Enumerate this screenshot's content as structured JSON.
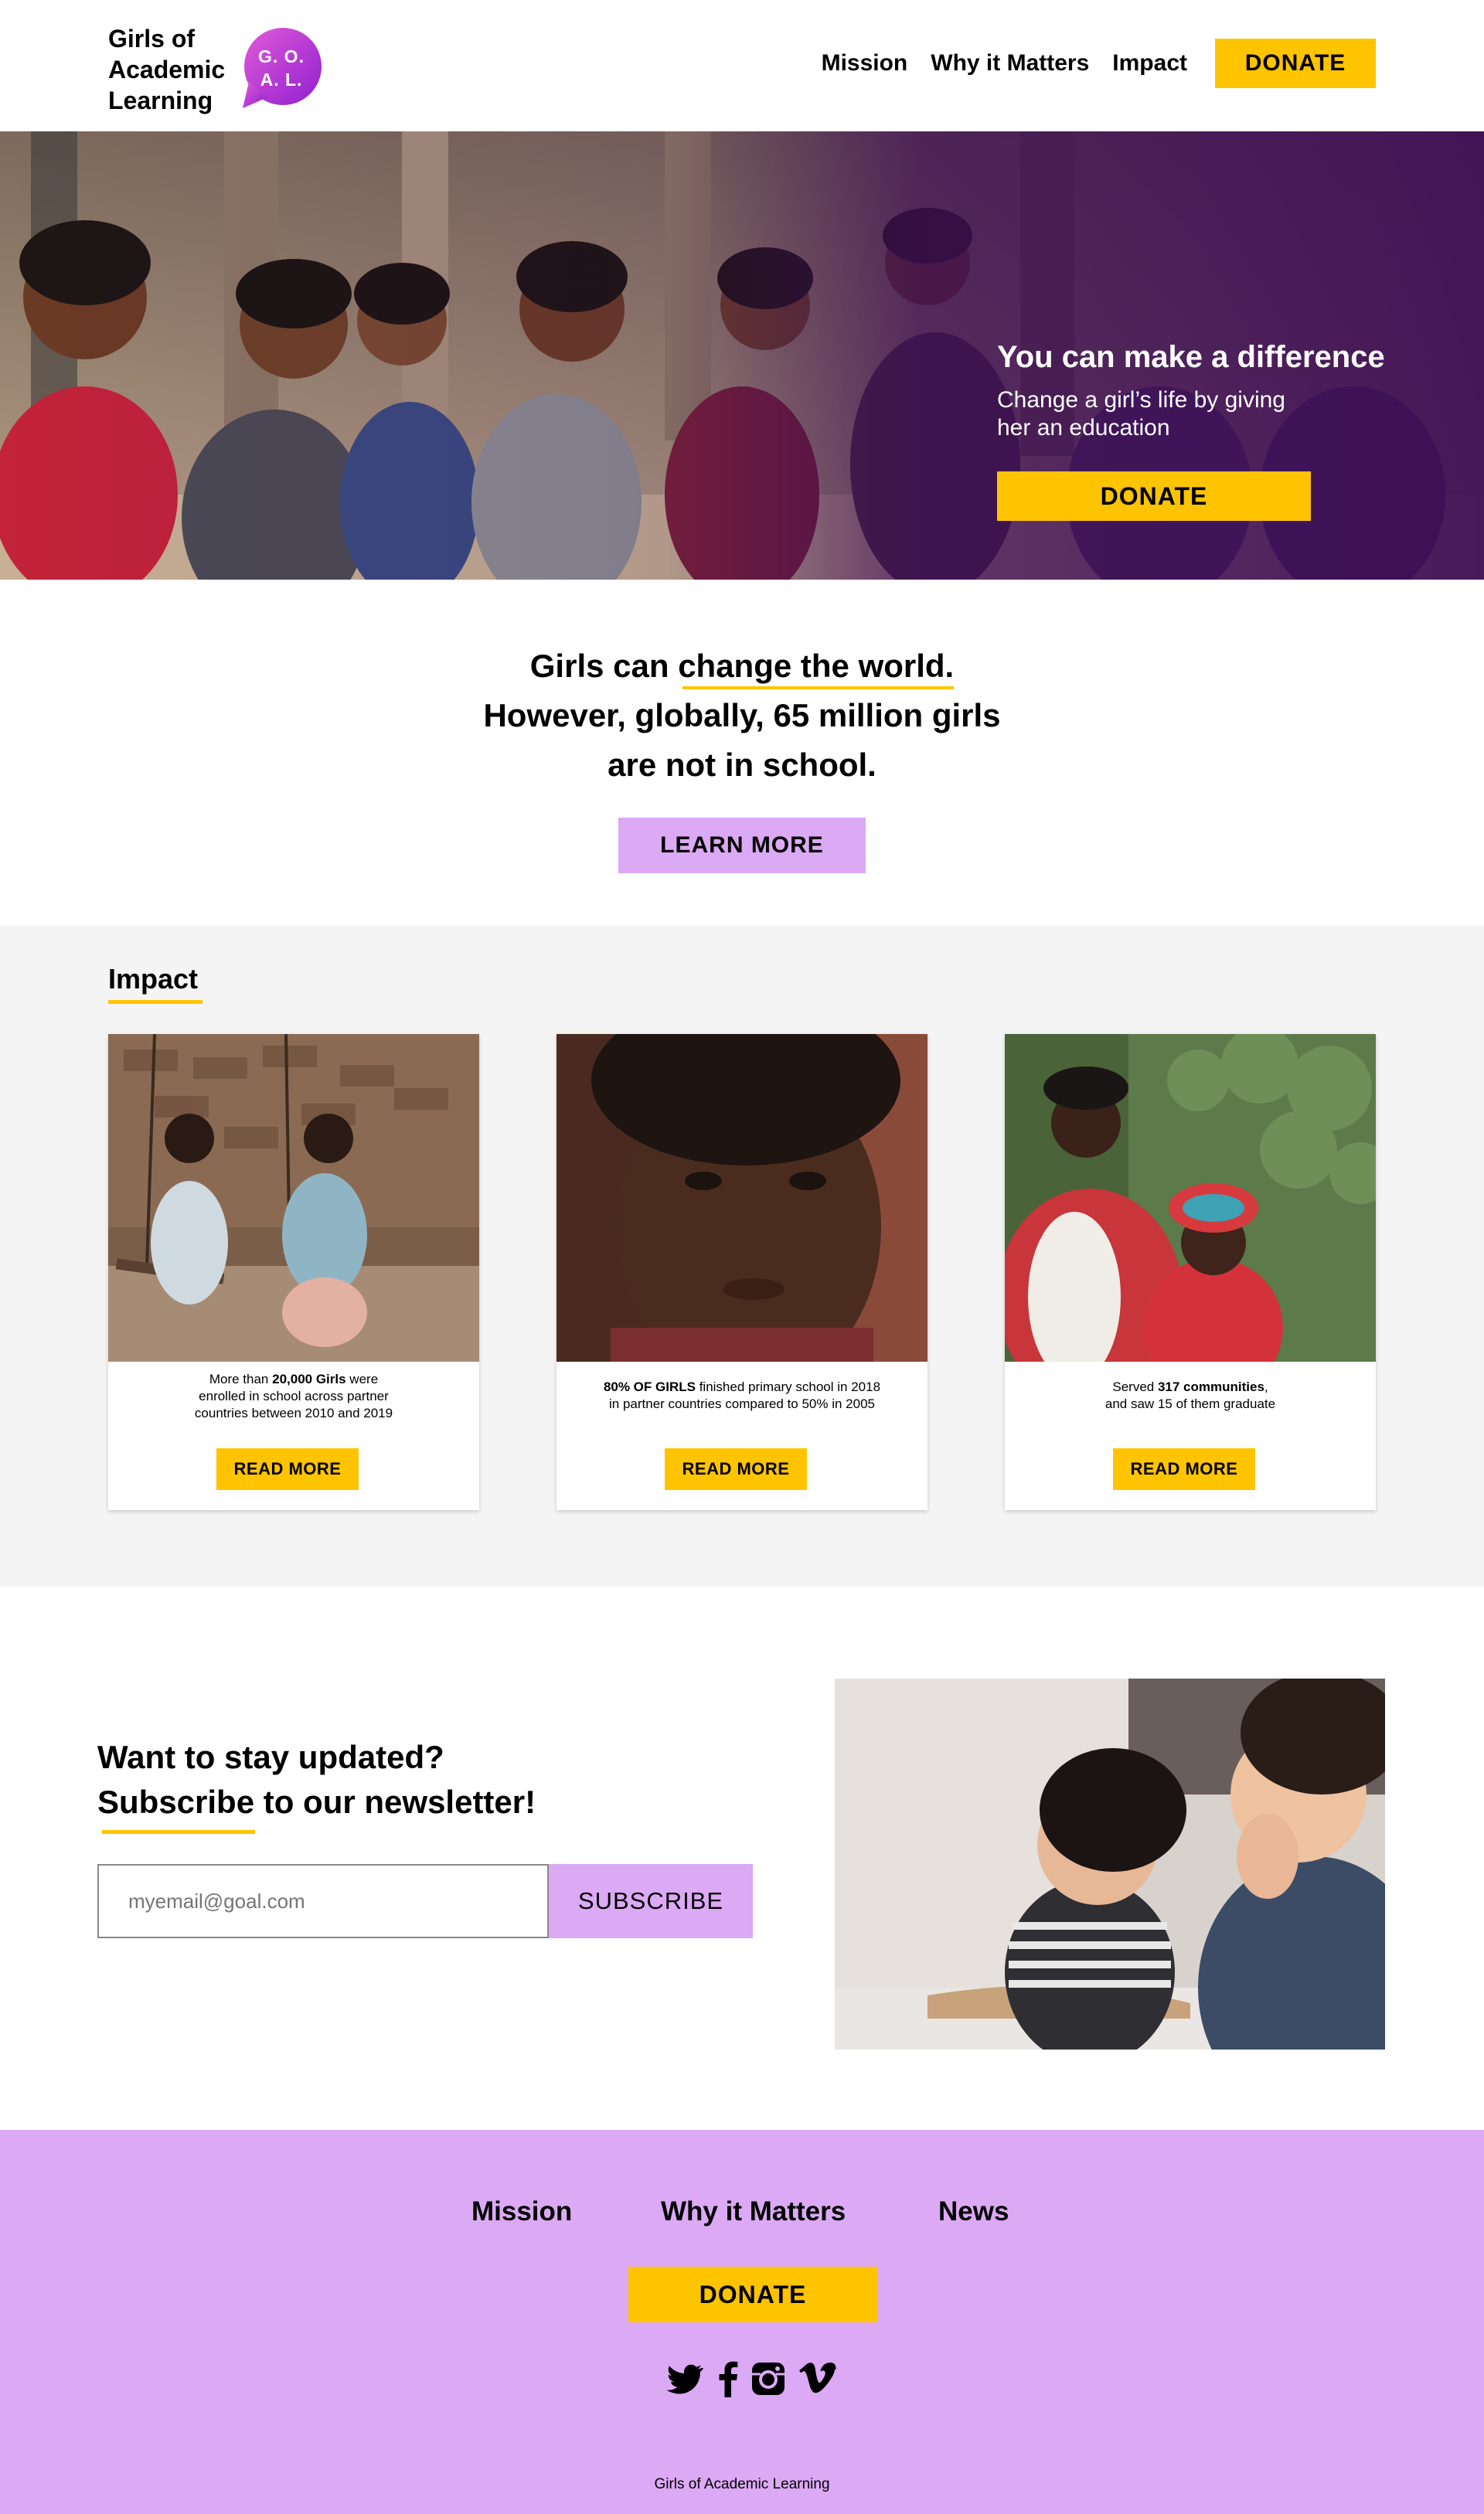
{
  "brand": {
    "name_line1": "Girls of",
    "name_line2": "Academic",
    "name_line3": "Learning",
    "badge_line1": "G. O.",
    "badge_line2": "A. L."
  },
  "nav": {
    "mission": "Mission",
    "why": "Why it Matters",
    "impact": "Impact",
    "donate": "DONATE"
  },
  "hero": {
    "title": "You can make a difference",
    "subtitle": "Change a girl’s life by giving her an education",
    "donate": "DONATE"
  },
  "statement": {
    "part1": "Girls can ",
    "highlight": "change the world.",
    "line2": "However, globally, 65 million girls",
    "line3": "are not in school.",
    "learn_more": "LEARN MORE"
  },
  "impact": {
    "title": "Impact",
    "cards": [
      {
        "pre": "More than ",
        "bold": "20,000 Girls",
        "post": " were",
        "line2": "enrolled in school across partner",
        "line3": "countries between 2010 and 2019",
        "button": "READ MORE"
      },
      {
        "bold": "80% OF GIRLS",
        "post": " finished primary school in 2018",
        "line2": "in partner countries compared to 50% in 2005",
        "button": "READ MORE"
      },
      {
        "pre": "Served ",
        "bold": "317 communities",
        "post": ",",
        "line2": "and saw 15 of them graduate",
        "button": "READ MORE"
      }
    ]
  },
  "newsletter": {
    "line1": "Want to stay updated?",
    "highlight": "Subscribe",
    "line2_rest": " to our newsletter!",
    "email_placeholder": "myemail@goal.com",
    "subscribe": "SUBSCRIBE"
  },
  "footer": {
    "mission": "Mission",
    "why": "Why it Matters",
    "news": "News",
    "donate": "DONATE",
    "social": [
      "twitter-icon",
      "facebook-icon",
      "instagram-icon",
      "vimeo-icon"
    ],
    "copyright": "Girls of Academic Learning"
  },
  "colors": {
    "accent_yellow": "#ffc400",
    "accent_lilac": "#dca9f5",
    "impact_bg": "#f4f4f4",
    "badge_gradient_start": "#e25bd8",
    "badge_gradient_end": "#8f1fd0"
  }
}
